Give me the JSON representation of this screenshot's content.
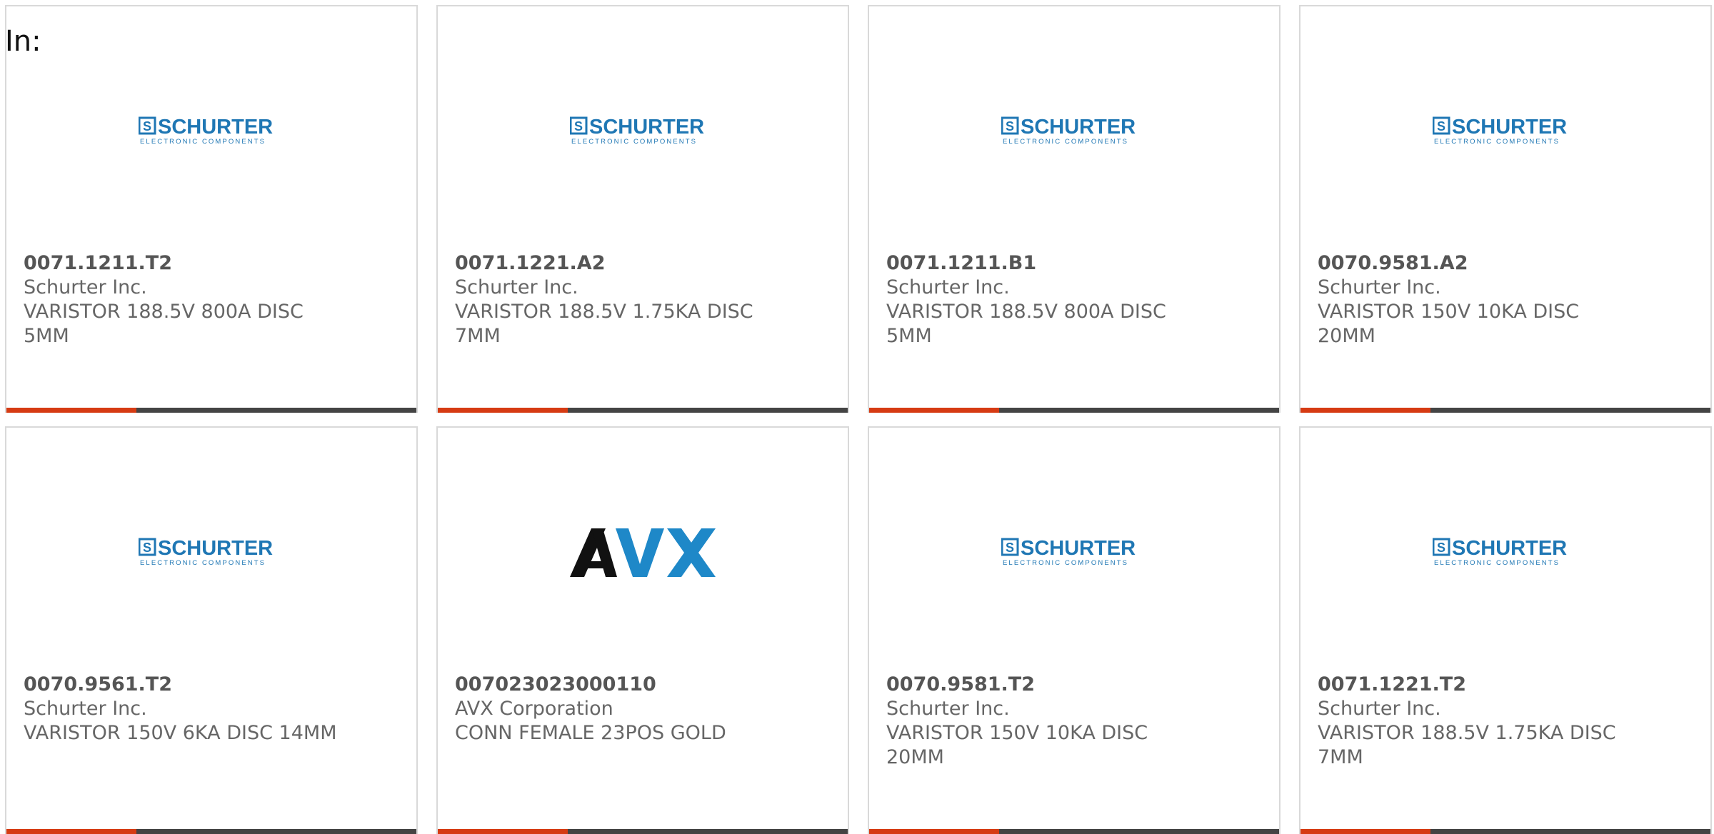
{
  "filter_label": "In:",
  "brand_colors": {
    "accent": "#d63b13",
    "bar_dark": "#444444",
    "schurter_blue": "#1f77b4",
    "avx_blue": "#1e88c8",
    "avx_black": "#111111"
  },
  "logos": {
    "schurter": {
      "name": "SCHURTER",
      "tagline": "ELECTRONIC COMPONENTS",
      "icon": "schurter-logo"
    },
    "avx": {
      "name": "AVX",
      "icon": "avx-logo"
    }
  },
  "products": [
    {
      "part": "0071.1211.T2",
      "manufacturer": "Schurter Inc.",
      "description": "VARISTOR 188.5V 800A DISC 5MM",
      "logo": "schurter"
    },
    {
      "part": "0071.1221.A2",
      "manufacturer": "Schurter Inc.",
      "description": "VARISTOR 188.5V 1.75KA DISC 7MM",
      "logo": "schurter"
    },
    {
      "part": "0071.1211.B1",
      "manufacturer": "Schurter Inc.",
      "description": "VARISTOR 188.5V 800A DISC 5MM",
      "logo": "schurter"
    },
    {
      "part": "0070.9581.A2",
      "manufacturer": "Schurter Inc.",
      "description": "VARISTOR 150V 10KA DISC 20MM",
      "logo": "schurter"
    },
    {
      "part": "0070.9561.T2",
      "manufacturer": "Schurter Inc.",
      "description": "VARISTOR 150V 6KA DISC 14MM",
      "logo": "schurter"
    },
    {
      "part": "007023023000110",
      "manufacturer": "AVX Corporation",
      "description": "CONN FEMALE 23POS GOLD",
      "logo": "avx"
    },
    {
      "part": "0070.9581.T2",
      "manufacturer": "Schurter Inc.",
      "description": "VARISTOR 150V 10KA DISC 20MM",
      "logo": "schurter"
    },
    {
      "part": "0071.1221.T2",
      "manufacturer": "Schurter Inc.",
      "description": "VARISTOR 188.5V 1.75KA DISC 7MM",
      "logo": "schurter"
    }
  ]
}
